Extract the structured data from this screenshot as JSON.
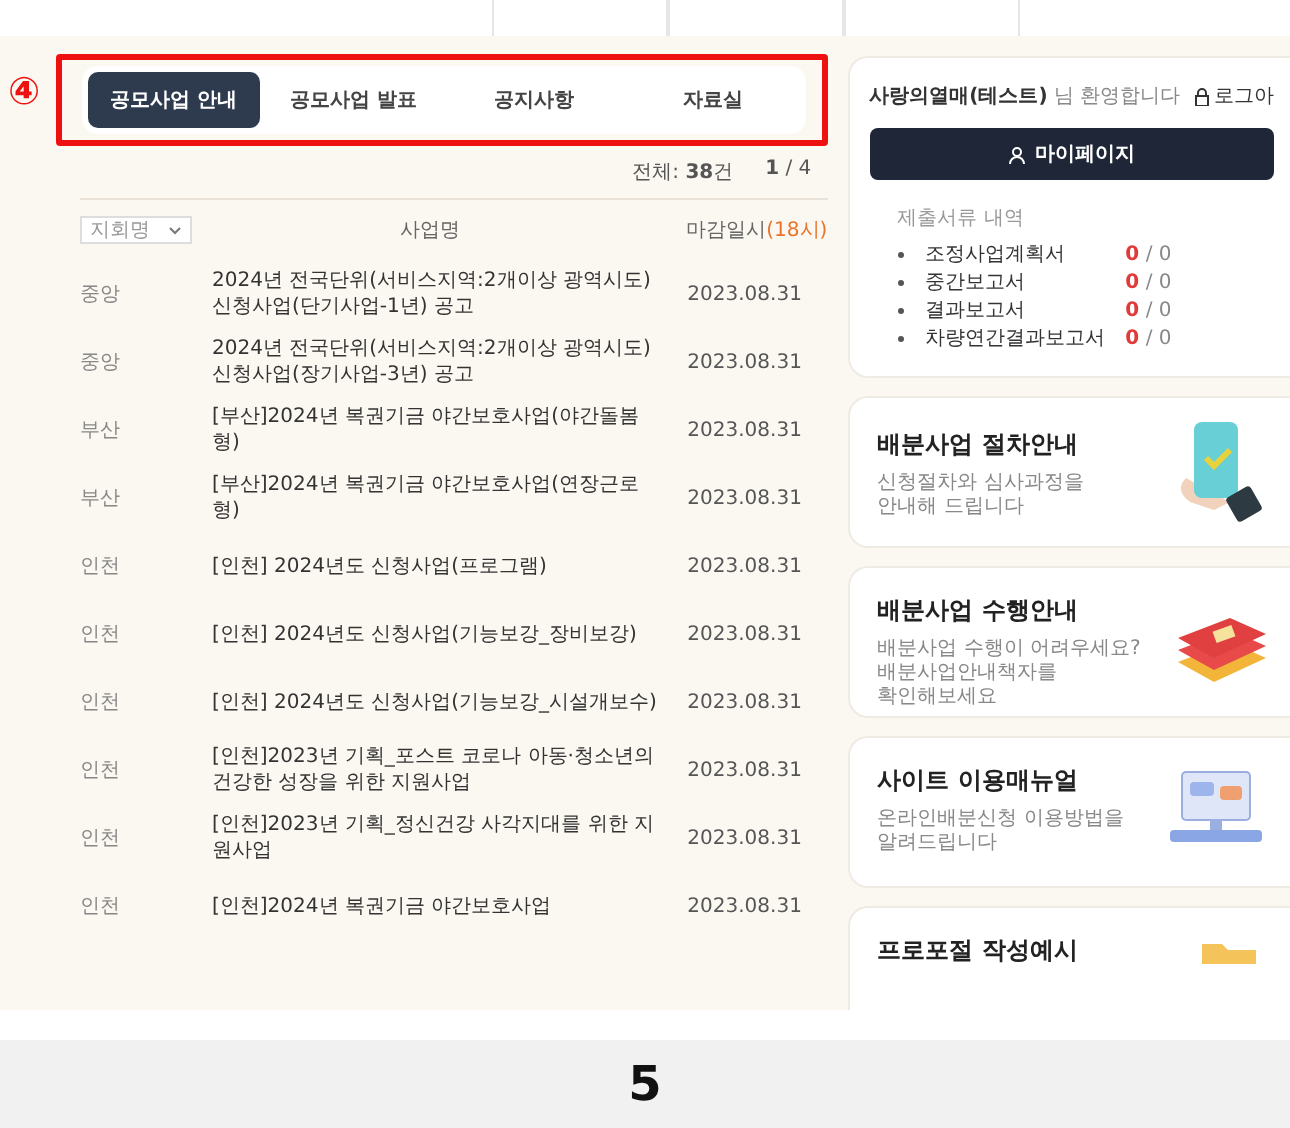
{
  "annotation": {
    "marker": "④"
  },
  "tabs": [
    {
      "label": "공모사업 안내",
      "selected": true
    },
    {
      "label": "공모사업 발표",
      "selected": false
    },
    {
      "label": "공지사항",
      "selected": false
    },
    {
      "label": "자료실",
      "selected": false
    }
  ],
  "list_meta": {
    "total": "전체: **38**건",
    "page": "**1** / 4"
  },
  "table": {
    "filter": {
      "placeholder": "지회명"
    },
    "title_column": "사업명",
    "deadline_column": "마감일시",
    "deadline_note": "(18시)",
    "rows": [
      {
        "region": "중앙",
        "title": "2024년 전국단위(서비스지역:2개이상 광역시도) 신청사업(단기사업-1년) 공고",
        "deadline": "2023.08.31"
      },
      {
        "region": "중앙",
        "title": "2024년 전국단위(서비스지역:2개이상 광역시도) 신청사업(장기사업-3년) 공고",
        "deadline": "2023.08.31"
      },
      {
        "region": "부산",
        "title": "[부산]2024년 복권기금 야간보호사업(야간돌봄형)",
        "deadline": "2023.08.31"
      },
      {
        "region": "부산",
        "title": "[부산]2024년 복권기금 야간보호사업(연장근로형)",
        "deadline": "2023.08.31"
      },
      {
        "region": "인천",
        "title": "[인천] 2024년도 신청사업(프로그램)",
        "deadline": "2023.08.31"
      },
      {
        "region": "인천",
        "title": "[인천] 2024년도 신청사업(기능보강_장비보강)",
        "deadline": "2023.08.31"
      },
      {
        "region": "인천",
        "title": "[인천] 2024년도 신청사업(기능보강_시설개보수)",
        "deadline": "2023.08.31"
      },
      {
        "region": "인천",
        "title": "[인천]2023년 기획_포스트 코로나 아동·청소년의 건강한 성장을 위한 지원사업",
        "deadline": "2023.08.31"
      },
      {
        "region": "인천",
        "title": "[인천]2023년 기획_정신건강 사각지대를 위한 지원사업",
        "deadline": "2023.08.31"
      },
      {
        "region": "인천",
        "title": "[인천]2024년 복권기금 야간보호사업",
        "deadline": "2023.08.31"
      }
    ]
  },
  "profile": {
    "user": "사랑의열매(테스트)",
    "greeting": "님 환영합니다",
    "logout": "로그아",
    "mypage": "마이페이지",
    "docs_title": "제출서류 내역",
    "docs": [
      {
        "name": "조정사업계획서",
        "submitted": "0",
        "separator": "/",
        "total": "0"
      },
      {
        "name": "중간보고서",
        "submitted": "0",
        "separator": "/",
        "total": "0"
      },
      {
        "name": "결과보고서",
        "submitted": "0",
        "separator": "/",
        "total": "0"
      },
      {
        "name": "차량연간결과보고서",
        "submitted": "0",
        "separator": "/",
        "total": "0"
      }
    ]
  },
  "guide_cards": [
    {
      "kind": "phone",
      "title": "배분사업 절차안내",
      "lines": [
        "신청절차와 심사과정을",
        "안내해 드립니다"
      ]
    },
    {
      "kind": "books",
      "title": "배분사업 수행안내",
      "lines": [
        "배분사업 수행이 어려우세요?",
        "배분사업안내책자를",
        "확인해보세요"
      ]
    },
    {
      "kind": "computer",
      "title": "사이트 이용매뉴얼",
      "lines": [
        "온라인배분신청 이용방법을",
        "알려드립니다"
      ]
    },
    {
      "kind": "folder",
      "title": "프로포절 작성예시"
    }
  ],
  "page_number": "5"
}
